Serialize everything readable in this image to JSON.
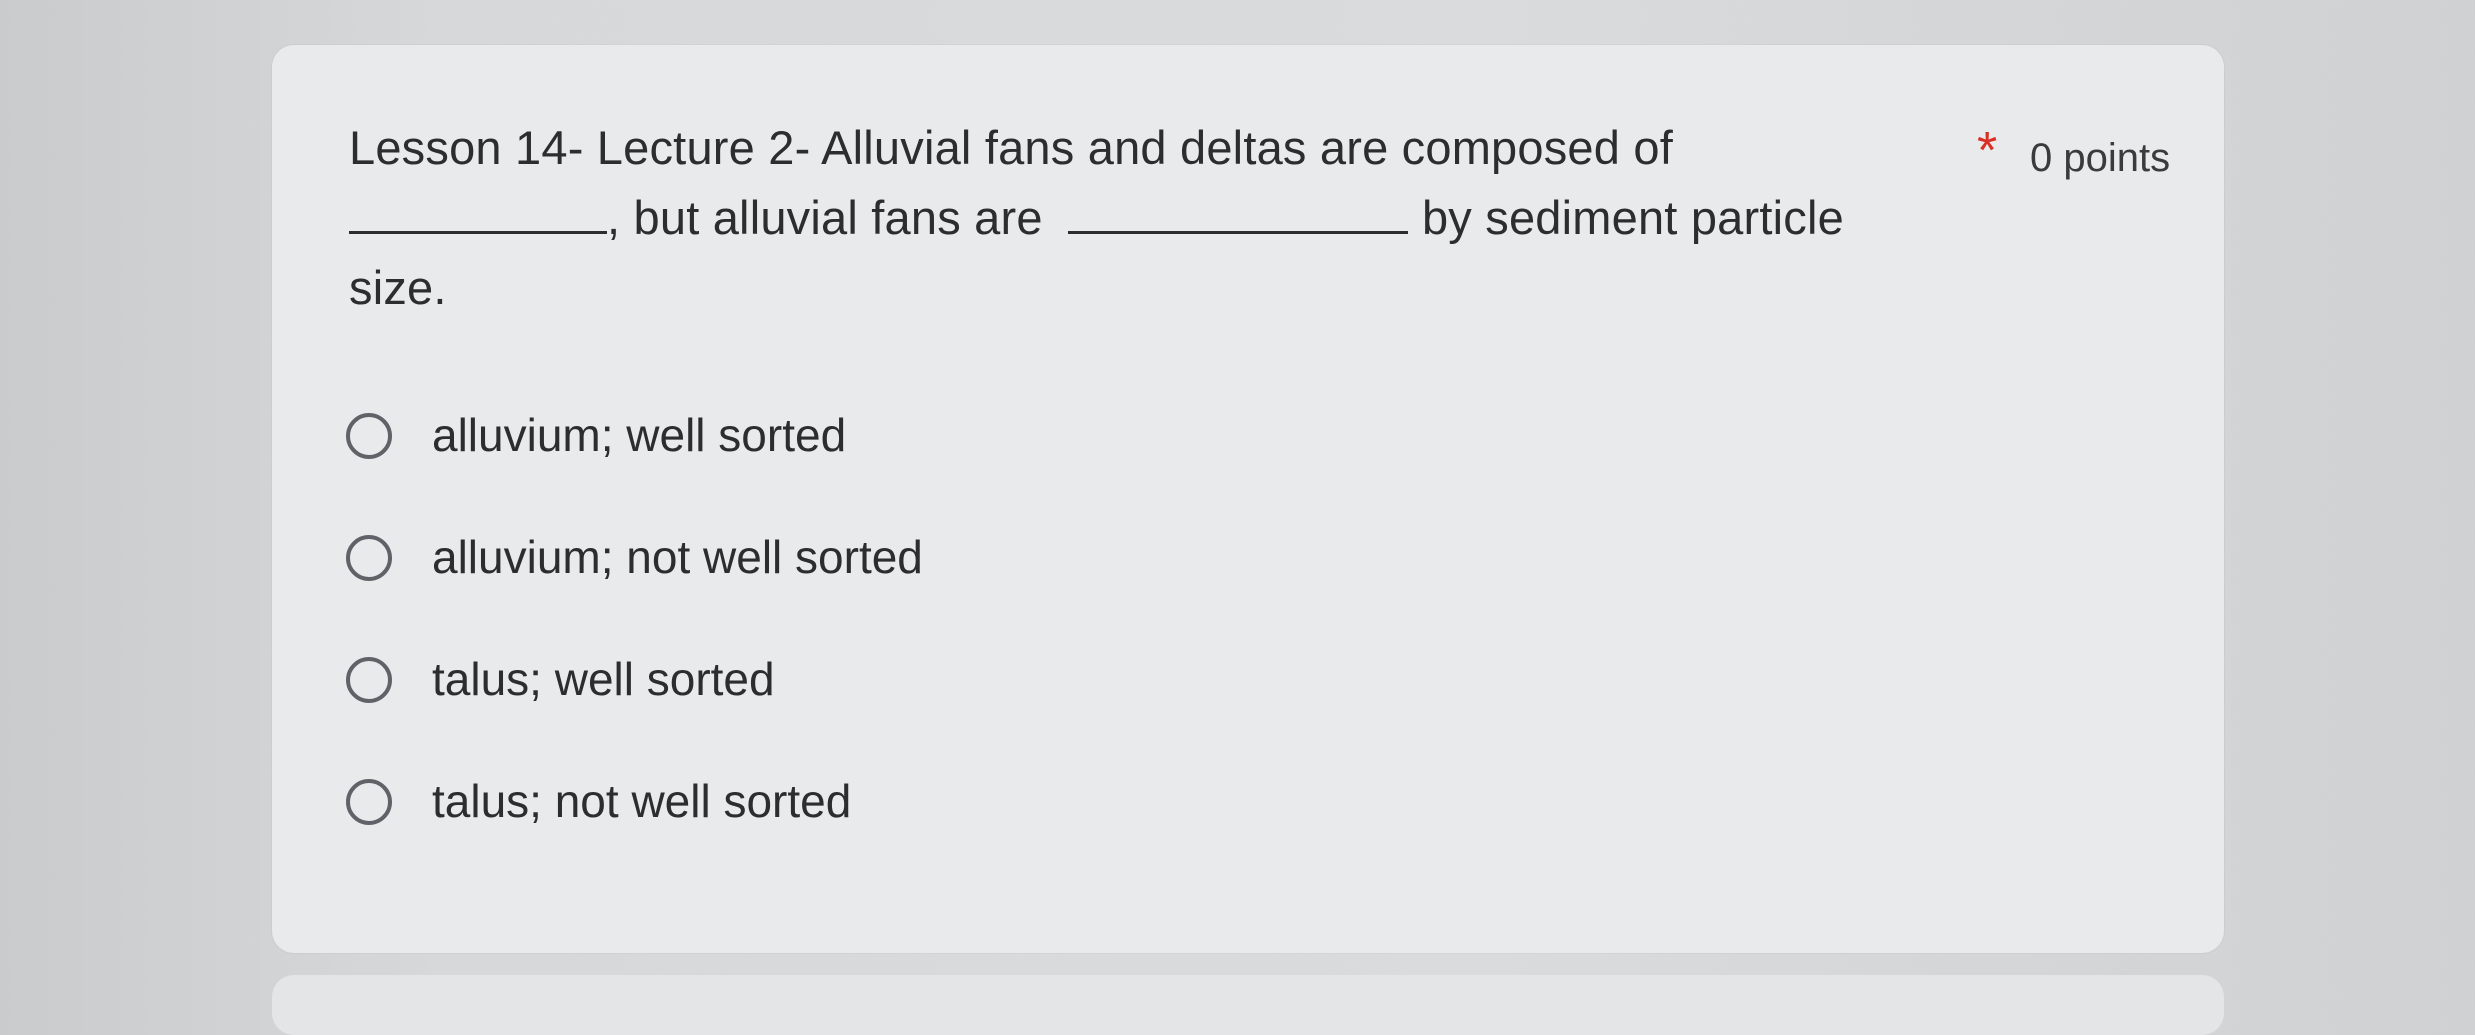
{
  "question": {
    "part1": "Lesson 14- Lecture 2-  Alluvial fans and deltas are composed of",
    "part2": ", but alluvial fans are",
    "part3": "by sediment particle size.",
    "required_marker": "*",
    "points": "0 points"
  },
  "options": [
    {
      "label": "alluvium; well sorted",
      "selected": false
    },
    {
      "label": "alluvium; not well sorted",
      "selected": false
    },
    {
      "label": "talus; well sorted",
      "selected": false
    },
    {
      "label": "talus; not well sorted",
      "selected": false
    }
  ],
  "colors": {
    "required_star": "#d93025",
    "text": "#2c2d2f",
    "radio_border": "#5f6368",
    "card_background": "#e9eaeb"
  }
}
